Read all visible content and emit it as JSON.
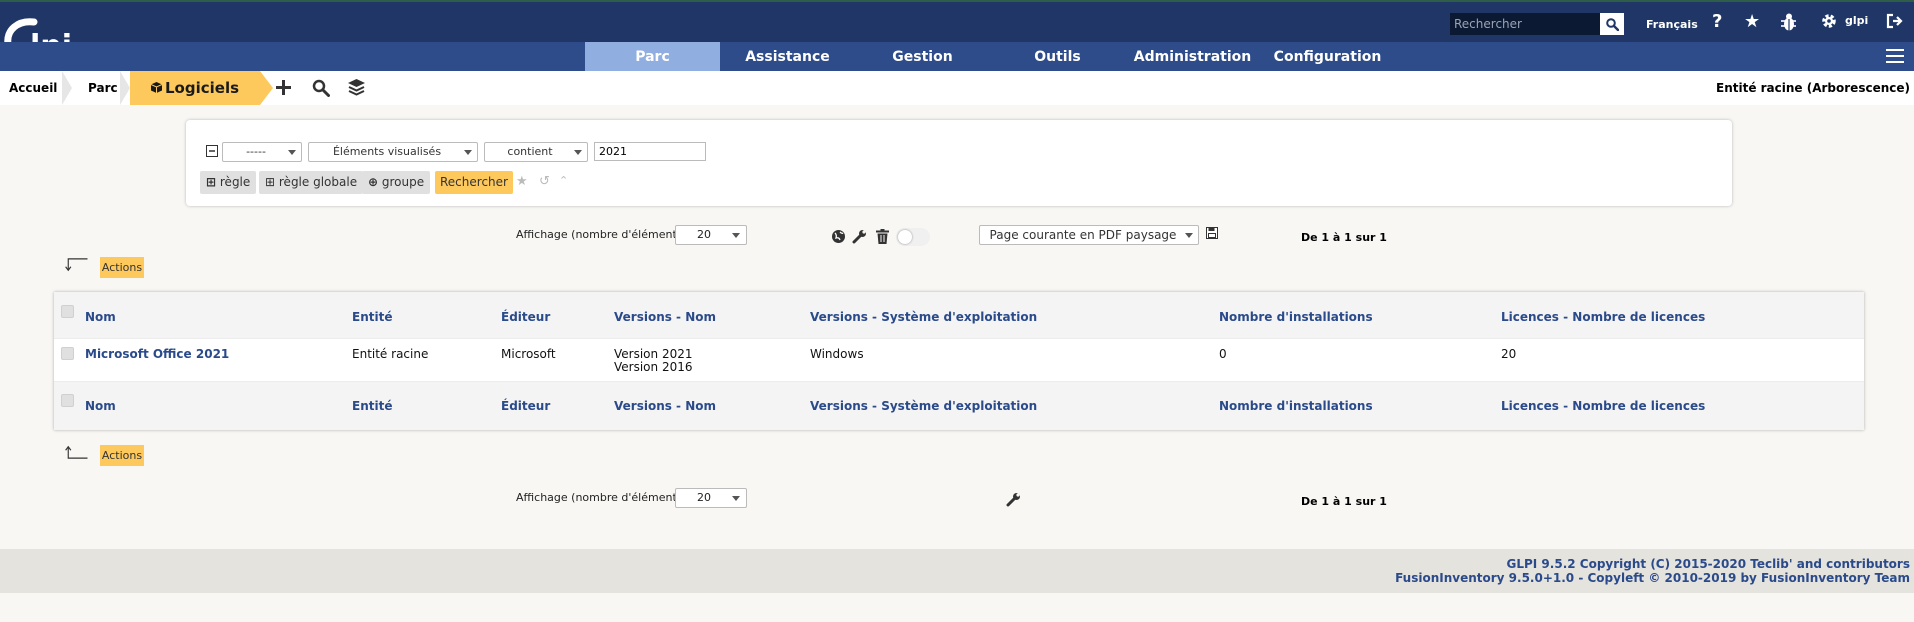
{
  "header": {
    "logo_text": "Glpi",
    "search_placeholder": "Rechercher",
    "language": "Français",
    "user": "glpi",
    "icons": [
      "search-icon",
      "help-icon",
      "star-icon",
      "bug-icon",
      "gear-icon",
      "logout-icon"
    ]
  },
  "menu": {
    "items": [
      {
        "label": "Parc",
        "active": true
      },
      {
        "label": "Assistance"
      },
      {
        "label": "Gestion"
      },
      {
        "label": "Outils"
      },
      {
        "label": "Administration"
      },
      {
        "label": "Configuration"
      }
    ]
  },
  "breadcrumb": {
    "home": "Accueil",
    "section": "Parc",
    "current": "Logiciels",
    "entity": "Entité racine (Arborescence)"
  },
  "search": {
    "link_select": "-----",
    "field_select": "Éléments visualisés",
    "operator_select": "contient",
    "value": "2021",
    "add_rule": "règle",
    "add_global_rule": "règle globale",
    "add_group": "groupe",
    "submit": "Rechercher"
  },
  "pager": {
    "label": "Affichage (nombre d'éléments)",
    "per_page": "20",
    "export_option": "Page courante en PDF paysage",
    "count": "De 1 à 1 sur 1"
  },
  "actions_label": "Actions",
  "table": {
    "columns": [
      "Nom",
      "Entité",
      "Éditeur",
      "Versions - Nom",
      "Versions - Système d'exploitation",
      "Nombre d'installations",
      "Licences - Nombre de licences"
    ],
    "rows": [
      {
        "name": "Microsoft Office 2021",
        "entity": "Entité racine",
        "editor": "Microsoft",
        "versions": [
          "Version 2021",
          "Version 2016"
        ],
        "os": "Windows",
        "installations": "0",
        "licenses": "20"
      }
    ]
  },
  "footer": {
    "line1": "GLPI 9.5.2 Copyright (C) 2015-2020 Teclib' and contributors",
    "line2": "FusionInventory 9.5.0+1.0 - Copyleft © 2010-2019 by FusionInventory Team"
  },
  "colors": {
    "header_bg": "#1f3667",
    "menu_bg": "#2e4c89",
    "menu_active": "#91aee0",
    "accent": "#fec95c",
    "link": "#2a4a8a"
  }
}
